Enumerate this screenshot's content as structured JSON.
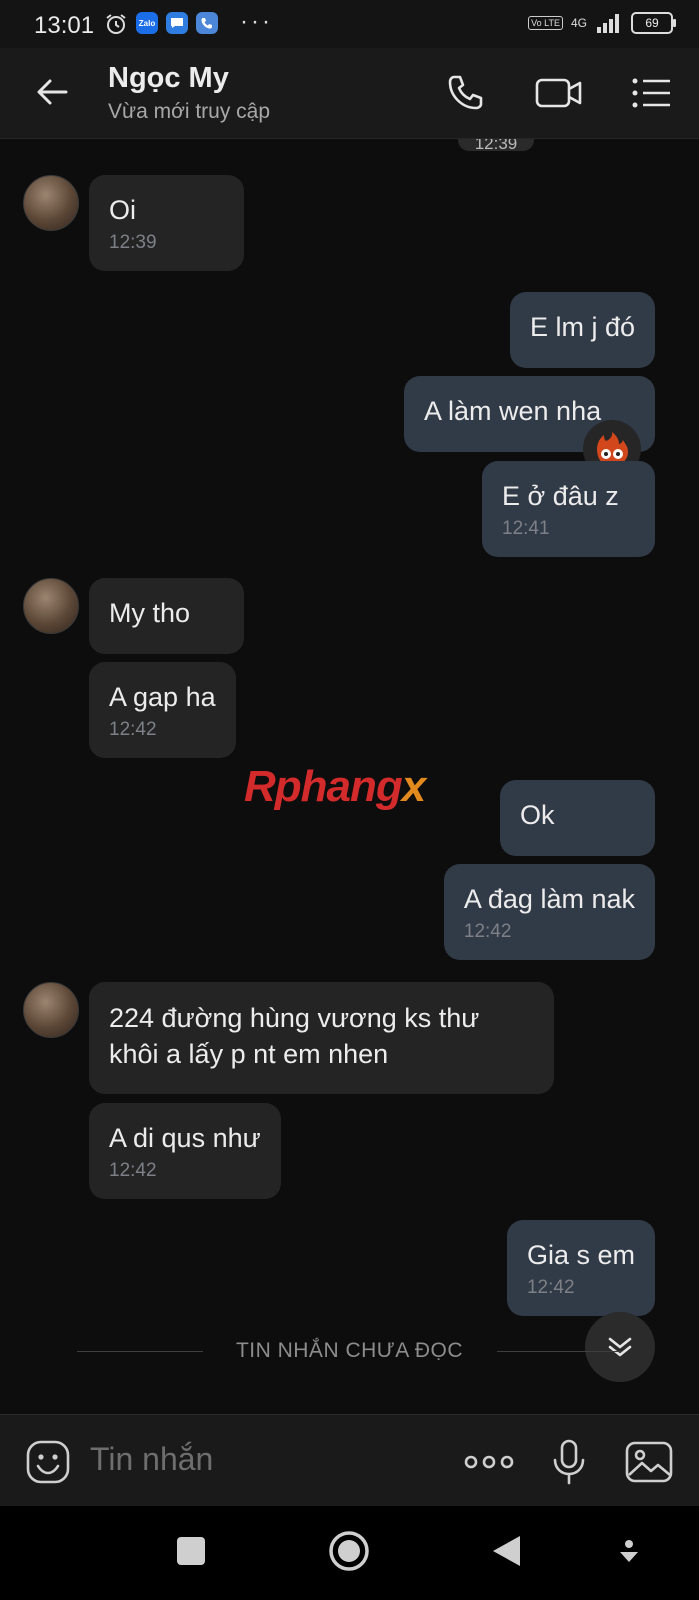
{
  "status_bar": {
    "time": "13:01",
    "icons": [
      "alarm-icon",
      "zalo-icon",
      "messages-icon",
      "phone-app-icon"
    ],
    "overflow": "···",
    "network": "4G",
    "volte": "Vo LTE",
    "battery": "69"
  },
  "header": {
    "contact_name": "Ngọc My",
    "presence": "Vừa mới truy cập",
    "actions": [
      "phone-icon",
      "video-call-icon",
      "menu-list-icon"
    ]
  },
  "chat": {
    "partial_time": "12:39",
    "messages": [
      {
        "dir": "in",
        "text": "Oi",
        "time": "12:39"
      },
      {
        "dir": "out",
        "text": "E lm j đó",
        "time": ""
      },
      {
        "dir": "out",
        "text": "A làm wen nha",
        "time": ""
      },
      {
        "dir": "out",
        "text": "E ở đâu z",
        "time": "12:41"
      },
      {
        "dir": "in",
        "text": "My tho",
        "time": ""
      },
      {
        "dir": "in",
        "text": "A gap ha",
        "time": "12:42"
      },
      {
        "dir": "out",
        "text": "Ok",
        "time": ""
      },
      {
        "dir": "out",
        "text": "A đag làm nak",
        "time": "12:42"
      },
      {
        "dir": "in",
        "text": "224 đường hùng vương ks thư khôi a lấy p nt em nhen",
        "time": ""
      },
      {
        "dir": "in",
        "text": "A di qus như",
        "time": "12:42"
      },
      {
        "dir": "out",
        "text": "Gia s em",
        "time": "12:42"
      }
    ],
    "unread_divider": "TIN NHẮN CHƯA ĐỌC",
    "watermark": {
      "part1": "Rphang",
      "part2": "x"
    }
  },
  "composer": {
    "placeholder": "Tin nhắn"
  },
  "colors": {
    "background": "#0d0d0d",
    "incoming_bubble": "#242424",
    "outgoing_bubble": "#313a47",
    "timestamp": "#7d8087"
  }
}
